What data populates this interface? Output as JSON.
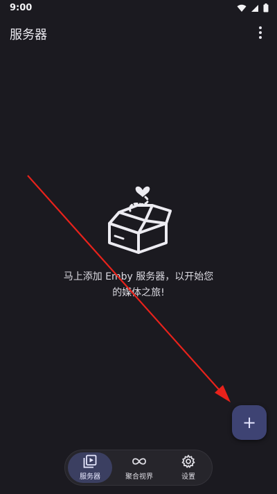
{
  "status_bar": {
    "time": "9:00",
    "icons": [
      "wifi-icon",
      "signal-icon",
      "battery-icon"
    ]
  },
  "app_bar": {
    "title": "服务器",
    "menu_icon": "more-vert-icon"
  },
  "empty_state": {
    "illustration_icon": "open-box-icon",
    "message_line1": "马上添加 Emby 服务器，以开始您",
    "message_line2": "的媒体之旅!"
  },
  "fab": {
    "icon": "plus-icon",
    "label": "+"
  },
  "bottom_nav": {
    "items": [
      {
        "label": "服务器",
        "icon": "play-library-icon",
        "active": true
      },
      {
        "label": "聚合视界",
        "icon": "infinity-icon",
        "active": false
      },
      {
        "label": "设置",
        "icon": "gear-icon",
        "active": false
      }
    ]
  },
  "colors": {
    "background": "#1b1a20",
    "fab": "#3e4373",
    "nav_active": "#3b3f61",
    "annotation_arrow": "#e8221b"
  }
}
